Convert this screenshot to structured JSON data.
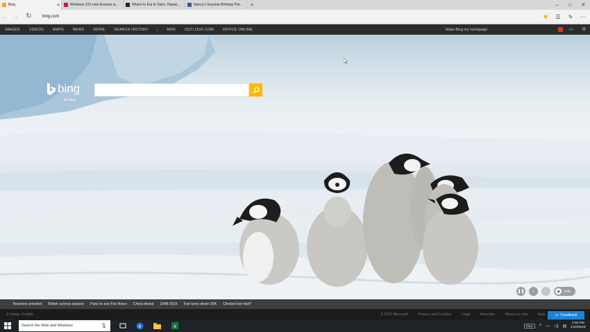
{
  "browser": {
    "tabs": [
      {
        "label": "Bing",
        "favicon_color": "#f5a623",
        "active": true
      },
      {
        "label": "Windows 10's new browser w...",
        "favicon_color": "#c2185b",
        "active": false
      },
      {
        "label": "Where to Eat in Oahu, Hawai...",
        "favicon_color": "#222222",
        "active": false
      },
      {
        "label": "Nancy's Surprise Birthday Par...",
        "favicon_color": "#3b5998",
        "active": false
      }
    ],
    "new_tab_glyph": "+",
    "window_controls": [
      "–",
      "□",
      "✕"
    ],
    "address": "bing.com",
    "icons": {
      "back": "back-arrow-icon",
      "forward": "forward-arrow-icon",
      "refresh": "refresh-icon",
      "favorite": "star-icon",
      "reading": "reading-list-icon",
      "note": "web-note-icon",
      "more": "more-icon"
    }
  },
  "bing_nav": {
    "links": [
      "IMAGES",
      "VIDEOS",
      "MAPS",
      "NEWS",
      "MORE",
      "SEARCH HISTORY"
    ],
    "separator": "|",
    "right_links": [
      "MSN",
      "OUTLOOK.COM",
      "OFFICE ONLINE"
    ],
    "homepage": "Make Bing my homepage",
    "lang": "EN"
  },
  "bing": {
    "logo_text": "bing",
    "subtext": "MS Beta",
    "search_placeholder": "",
    "search_value": ""
  },
  "news": [
    "Teachers arrested",
    "British actress passes",
    "Paris to sue Fox News",
    "China denial",
    "1948-2015",
    "Fan turns down 20K",
    "Climbed too fast?"
  ],
  "controls": {
    "info_label": "Info",
    "collapse_glyph": "⌄"
  },
  "footer": {
    "credits": "© Image Credits",
    "links": [
      "© 2015 Microsoft",
      "Privacy and Cookies",
      "Legal",
      "Advertise",
      "About our ads",
      "Help"
    ],
    "feedback": "Feedback"
  },
  "taskbar": {
    "search_placeholder": "Search the Web and Windows",
    "apps": [
      "task-view-icon",
      "ie-browser-icon",
      "file-explorer-icon",
      "excel-icon"
    ],
    "keyboard": "ENG",
    "time": "2:56 PM",
    "date": "1/20/2015"
  }
}
